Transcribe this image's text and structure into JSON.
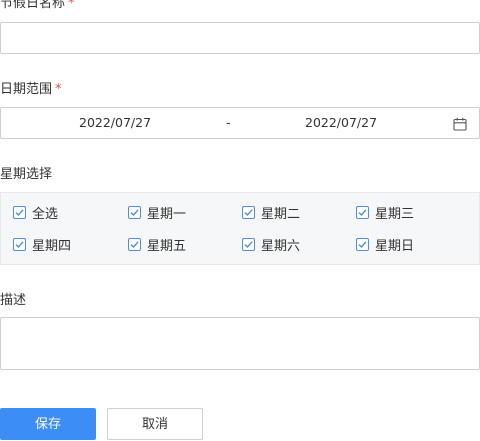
{
  "form": {
    "holiday_name": {
      "label": "节假日名称",
      "required_mark": "*",
      "value": ""
    },
    "date_range": {
      "label": "日期范围",
      "required_mark": "*",
      "start": "2022/07/27",
      "separator": "-",
      "end": "2022/07/27",
      "icon": "calendar-icon"
    },
    "week_select": {
      "label": "星期选择",
      "options": [
        {
          "label": "全选",
          "checked": true
        },
        {
          "label": "星期一",
          "checked": true
        },
        {
          "label": "星期二",
          "checked": true
        },
        {
          "label": "星期三",
          "checked": true
        },
        {
          "label": "星期四",
          "checked": true
        },
        {
          "label": "星期五",
          "checked": true
        },
        {
          "label": "星期六",
          "checked": true
        },
        {
          "label": "星期日",
          "checked": true
        }
      ]
    },
    "description": {
      "label": "描述",
      "value": ""
    }
  },
  "actions": {
    "save_label": "保存",
    "cancel_label": "取消"
  },
  "colors": {
    "primary": "#3c8df5",
    "required": "#e64545",
    "checkbox": "#4e8ee6"
  }
}
